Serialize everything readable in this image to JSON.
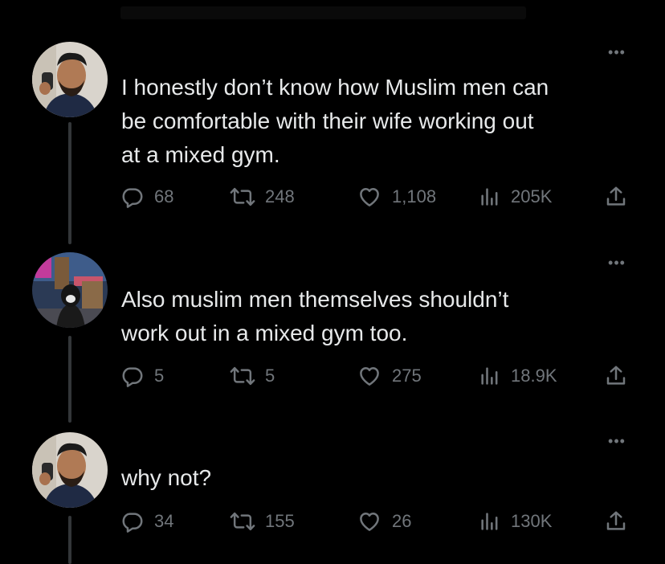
{
  "tweets": [
    {
      "text": "I honestly don’t know how Muslim men can\nbe comfortable with their wife working out\nat a mixed gym.",
      "more_label": "•••",
      "replies": "68",
      "retweets": "248",
      "likes": "1,108",
      "views": "205K"
    },
    {
      "text": "Also muslim men themselves shouldn’t\nwork out in a mixed gym too.",
      "more_label": "•••",
      "replies": "5",
      "retweets": "5",
      "likes": "275",
      "views": "18.9K"
    },
    {
      "text": "why not?",
      "more_label": "•••",
      "replies": "34",
      "retweets": "155",
      "likes": "26",
      "views": "130K"
    }
  ],
  "icons": {
    "reply": "reply-icon",
    "retweet": "retweet-icon",
    "like": "heart-icon",
    "views": "views-icon",
    "share": "share-icon"
  },
  "colors": {
    "background": "#000000",
    "text": "#e7e9ea",
    "secondary": "#71767b",
    "thread_line": "#333639"
  }
}
